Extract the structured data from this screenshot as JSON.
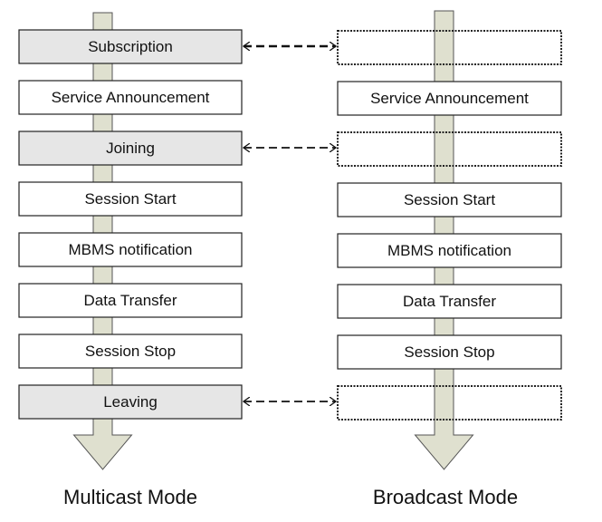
{
  "colors": {
    "shaft": "#dfe0cf",
    "shaft_border": "#555555",
    "gray_box": "#e6e6e6",
    "white_box": "#ffffff"
  },
  "multicast": {
    "title": "Multicast Mode",
    "steps": [
      {
        "label": "Subscription",
        "style": "gray"
      },
      {
        "label": "Service Announcement",
        "style": "white"
      },
      {
        "label": "Joining",
        "style": "gray"
      },
      {
        "label": "Session Start",
        "style": "white"
      },
      {
        "label": "MBMS notification",
        "style": "white"
      },
      {
        "label": "Data Transfer",
        "style": "white"
      },
      {
        "label": "Session Stop",
        "style": "white"
      },
      {
        "label": "Leaving",
        "style": "gray"
      }
    ]
  },
  "broadcast": {
    "title": "Broadcast Mode",
    "steps": [
      {
        "label": "",
        "style": "dotted"
      },
      {
        "label": "Service Announcement",
        "style": "white"
      },
      {
        "label": "",
        "style": "dotted"
      },
      {
        "label": "Session Start",
        "style": "white"
      },
      {
        "label": "MBMS notification",
        "style": "white"
      },
      {
        "label": "Data Transfer",
        "style": "white"
      },
      {
        "label": "Session Stop",
        "style": "white"
      },
      {
        "label": "",
        "style": "dotted"
      }
    ]
  },
  "links": [
    0,
    2,
    7
  ]
}
